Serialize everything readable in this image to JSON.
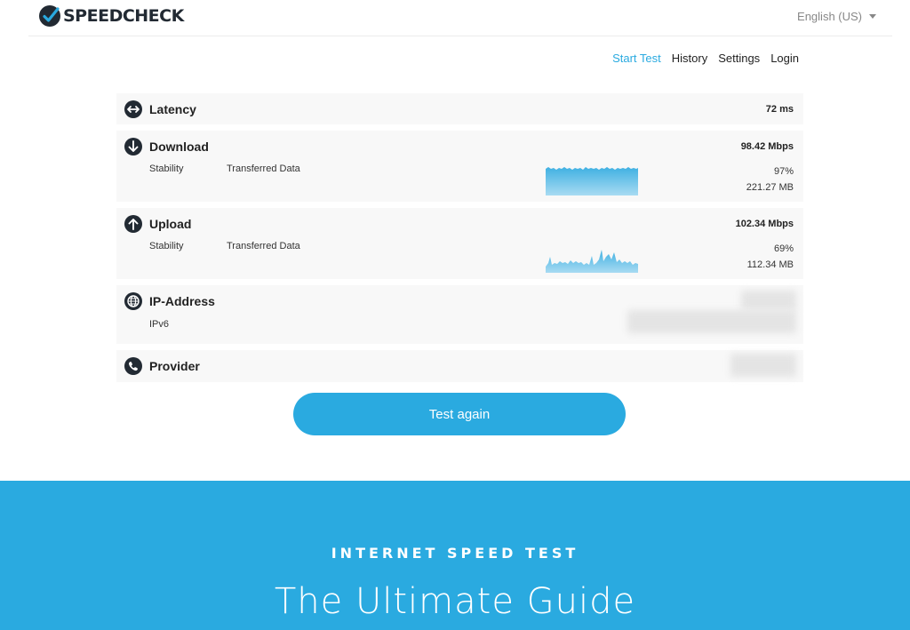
{
  "brand": {
    "name": "SPEEDCHECK"
  },
  "language": {
    "selected": "English (US)"
  },
  "nav": {
    "items": [
      "Start Test",
      "History",
      "Settings",
      "Login"
    ],
    "active": 0
  },
  "results": {
    "latency": {
      "label": "Latency",
      "value": "72 ms"
    },
    "download": {
      "label": "Download",
      "value": "98.42 Mbps",
      "stability_label": "Stability",
      "transferred_label": "Transferred Data",
      "stability": "97%",
      "transferred": "221.27 MB"
    },
    "upload": {
      "label": "Upload",
      "value": "102.34 Mbps",
      "stability_label": "Stability",
      "transferred_label": "Transferred Data",
      "stability": "69%",
      "transferred": "112.34 MB"
    },
    "ip": {
      "label": "IP-Address",
      "sub_label": "IPv6"
    },
    "provider": {
      "label": "Provider"
    }
  },
  "button": {
    "label": "Test again"
  },
  "banner": {
    "kicker": "INTERNET SPEED TEST",
    "title": "The Ultimate Guide"
  },
  "colors": {
    "accent": "#2aaae0",
    "dark": "#222a33",
    "row_bg": "#f8f8f8"
  }
}
